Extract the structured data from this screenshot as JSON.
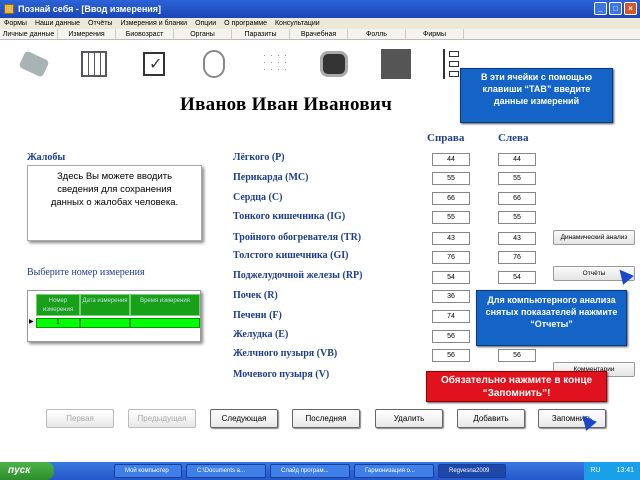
{
  "window": {
    "title": "Познай себя - [Ввод измерения]"
  },
  "menu": [
    "Формы",
    "Наши данные",
    "Отчёты",
    "Измерения и бланки",
    "Опции",
    "О программе",
    "Консультации"
  ],
  "tabs": [
    "Личные данные",
    "Измерения",
    "Биовозраст",
    "Органы",
    "Паразиты",
    "Врачебная",
    "Фолль",
    "Фирмы"
  ],
  "person": {
    "name": "Иванов Иван Иванович"
  },
  "columns": {
    "right": "Справа",
    "left": "Слева"
  },
  "complaints": {
    "title": "Жалобы",
    "text": "Здесь Вы можете вводить сведения для сохранения данных о жалобах человека."
  },
  "measurement": {
    "title": "Выберите номер измерения",
    "headers": [
      "Номер измерения",
      "Дата измерения",
      "Время измерения"
    ],
    "selected": "1"
  },
  "organs": [
    {
      "name": "Лёгкого (P)",
      "right": "44",
      "left": "44"
    },
    {
      "name": "Перикарда (МС)",
      "right": "55",
      "left": "55"
    },
    {
      "name": "Сердца (C)",
      "right": "66",
      "left": "66"
    },
    {
      "name": "Тонкого кишечника (IG)",
      "right": "55",
      "left": "55"
    },
    {
      "name": "Тройного обогревателя (TR)",
      "right": "43",
      "left": "43"
    },
    {
      "name": "Толстого кишечника (GI)",
      "right": "76",
      "left": "76"
    },
    {
      "name": "Поджелудочной железы (RP)",
      "right": "54",
      "left": "54"
    },
    {
      "name": "Почек (R)",
      "right": "36",
      "left": ""
    },
    {
      "name": "Печени (F)",
      "right": "74",
      "left": ""
    },
    {
      "name": "Желудка (E)",
      "right": "56",
      "left": ""
    },
    {
      "name": "Желчного пузыря (VB)",
      "right": "56",
      "left": "56"
    },
    {
      "name": "Мочевого пузыря (V)",
      "right": "",
      "left": ""
    }
  ],
  "side_buttons": {
    "dynamic": "Динамический анализ",
    "reports": "Отчёты",
    "comments": "Комментарии"
  },
  "tooltips": {
    "tab_hint": "В эти ячейки с помощью клавиши “TAB” введите данные измерений",
    "reports_hint": "Для компьютерного анализа снятых показателей нажмите “Отчеты”",
    "save_hint": "Обязательно нажмите в конце “Запомнить”!"
  },
  "nav_buttons": {
    "first": "Первая",
    "previous": "Предыдущая",
    "next": "Следующая",
    "last": "Последняя",
    "delete": "Удалить",
    "add": "Добавить",
    "save": "Запомнить"
  },
  "taskbar": {
    "start": "пуск",
    "tasks": [
      "Мой компьютер",
      "C:\\Documents a...",
      "Слайд програм...",
      "Гармонизация о...",
      "Regvesna2009"
    ],
    "lang": "RU",
    "time": "13:41"
  },
  "colors": {
    "accent": "#1d3e8c",
    "tip_blue": "#1464c8",
    "tip_red": "#e0121e",
    "grid_green": "#00ff00"
  }
}
